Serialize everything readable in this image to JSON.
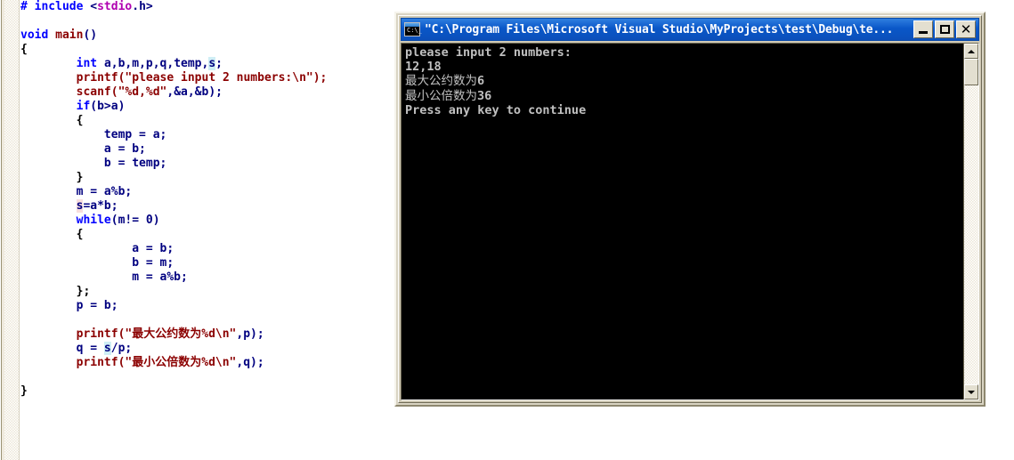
{
  "editor": {
    "name": "c-source-editor",
    "lines": [
      [
        {
          "t": "# include ",
          "c": "pre"
        },
        {
          "t": "<",
          "c": "id"
        },
        {
          "t": "stdio",
          "c": "hdr"
        },
        {
          "t": ".h>",
          "c": "id"
        }
      ],
      [],
      [
        {
          "t": "void ",
          "c": "kw"
        },
        {
          "t": "main",
          "c": "fn"
        },
        {
          "t": "()",
          "c": "id"
        }
      ],
      [
        {
          "t": "{",
          "c": "punct"
        }
      ],
      [
        {
          "t": "        ",
          "c": "id"
        },
        {
          "t": "int ",
          "c": "kw"
        },
        {
          "t": "a,b,m,p,q,temp,",
          "c": "id"
        },
        {
          "t": "s",
          "c": "id",
          "hl": "sel"
        },
        {
          "t": ";",
          "c": "id"
        }
      ],
      [
        {
          "t": "        ",
          "c": "id"
        },
        {
          "t": "printf(\"please input 2 numbers:\\n\");",
          "c": "str"
        }
      ],
      [
        {
          "t": "        ",
          "c": "id"
        },
        {
          "t": "scanf(\"%d,%d\"",
          "c": "str"
        },
        {
          "t": ",&a,&b);",
          "c": "id"
        }
      ],
      [
        {
          "t": "        ",
          "c": "id"
        },
        {
          "t": "if",
          "c": "kw"
        },
        {
          "t": "(b>a)",
          "c": "id"
        }
      ],
      [
        {
          "t": "        {",
          "c": "punct"
        }
      ],
      [
        {
          "t": "            temp = a;",
          "c": "id"
        }
      ],
      [
        {
          "t": "            a = b;",
          "c": "id"
        }
      ],
      [
        {
          "t": "            b = temp;",
          "c": "id"
        }
      ],
      [
        {
          "t": "        }",
          "c": "punct"
        }
      ],
      [
        {
          "t": "        m = a%b;",
          "c": "id"
        }
      ],
      [
        {
          "t": "        ",
          "c": "id"
        },
        {
          "t": "s",
          "c": "id",
          "hl": "sel2"
        },
        {
          "t": "=a*b;",
          "c": "id"
        }
      ],
      [
        {
          "t": "        ",
          "c": "id"
        },
        {
          "t": "while",
          "c": "kw"
        },
        {
          "t": "(m!= 0)",
          "c": "id"
        }
      ],
      [
        {
          "t": "        {",
          "c": "punct"
        }
      ],
      [
        {
          "t": "                a = b;",
          "c": "id"
        }
      ],
      [
        {
          "t": "                b = m;",
          "c": "id"
        }
      ],
      [
        {
          "t": "                m = a%b;",
          "c": "id"
        }
      ],
      [
        {
          "t": "        };",
          "c": "punct"
        }
      ],
      [
        {
          "t": "        p = b;",
          "c": "id"
        }
      ],
      [],
      [
        {
          "t": "        ",
          "c": "id"
        },
        {
          "t": "printf(\"最大公约数为%d\\n\"",
          "c": "str"
        },
        {
          "t": ",p);",
          "c": "id"
        }
      ],
      [
        {
          "t": "        q = ",
          "c": "id"
        },
        {
          "t": "s",
          "c": "id",
          "hl": "sel"
        },
        {
          "t": "/p;",
          "c": "id"
        }
      ],
      [
        {
          "t": "        ",
          "c": "id"
        },
        {
          "t": "printf(\"最小公倍数为%d\\n\"",
          "c": "str"
        },
        {
          "t": ",q);",
          "c": "id"
        }
      ],
      [],
      [
        {
          "t": "}",
          "c": "punct"
        }
      ]
    ]
  },
  "console_window": {
    "icon": "console-window-icon",
    "icon_prompt": "C:\\_",
    "title": "\"C:\\Program Files\\Microsoft Visual Studio\\MyProjects\\test\\Debug\\te...",
    "buttons": {
      "minimize": "minimize-button",
      "maximize": "maximize-button",
      "close_glyph": "✕"
    },
    "output_lines": [
      "please input 2 numbers:",
      "12,18",
      "最大公约数为6",
      "最小公倍数为36",
      "Press any key to continue"
    ],
    "scrollbar": {
      "up_arrow": "scroll-up-arrow",
      "down_arrow": "scroll-down-arrow"
    }
  },
  "colors": {
    "keyword": "#0000ff",
    "string": "#8b0000",
    "identifier": "#000080",
    "header": "#b000b0",
    "console_fg": "#c0c0c0",
    "console_bg": "#000000",
    "titlebar": "#0a57c8",
    "chrome": "#d9d4c3"
  }
}
